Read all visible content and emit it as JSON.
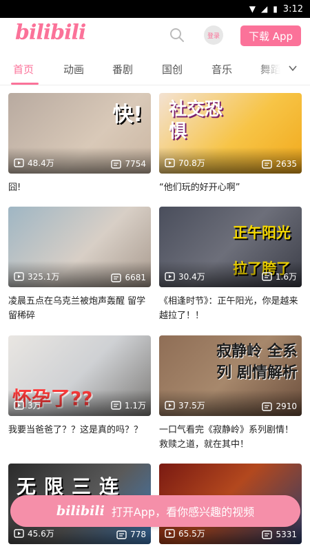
{
  "status": {
    "time": "3:12"
  },
  "header": {
    "logo": "bilibili",
    "login_label": "登录",
    "download_label": "下载 App"
  },
  "tabs": [
    "首页",
    "动画",
    "番剧",
    "国创",
    "音乐",
    "舞蹈"
  ],
  "videos": [
    {
      "overlay": "快!",
      "views": "48.4万",
      "danmaku": "7754",
      "title": "囧!"
    },
    {
      "overlay": "社交恐惧",
      "views": "70.8万",
      "danmaku": "2635",
      "title": "“他们玩的好开心啊”"
    },
    {
      "overlay": "",
      "views": "325.1万",
      "danmaku": "6681",
      "title": "凌晨五点在乌克兰被炮声轰醒 留学留稀碎"
    },
    {
      "overlay": "正午阳光 拉了胯了",
      "views": "30.4万",
      "danmaku": "1.6万",
      "title": "《相逢时节》：正午阳光，你是越来越拉了！！"
    },
    {
      "overlay": "怀孕了??",
      "views": "3万",
      "danmaku": "1.1万",
      "title": "我要当爸爸了？？这是真的吗？？"
    },
    {
      "overlay": "寂静岭 全系列 剧情解析",
      "views": "37.5万",
      "danmaku": "2910",
      "title": "一口气看完《寂静岭》系列剧情！救赎之道，就在其中！"
    },
    {
      "overlay": "无限三连",
      "views": "45.6万",
      "danmaku": "778",
      "title": ""
    },
    {
      "overlay": "",
      "views": "65.5万",
      "danmaku": "5331",
      "title": ""
    }
  ],
  "banner": {
    "logo": "bilibili",
    "text": "打开App，看你感兴趣的视频"
  },
  "colors": {
    "accent": "#fb7299"
  }
}
